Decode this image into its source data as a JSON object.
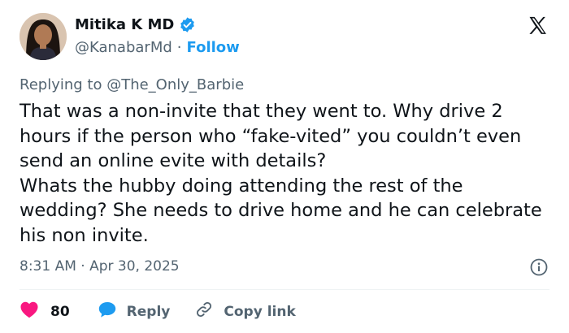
{
  "author": {
    "name": "Mitika K MD",
    "handle": "@KanabarMd",
    "separator": "·",
    "follow_label": "Follow"
  },
  "reply_context": {
    "prefix": "Replying to ",
    "mention": "@The_Only_Barbie"
  },
  "tweet": {
    "line1": "That was a non-invite that they went to. Why drive 2 hours if the person who “fake-vited” you couldn’t even send an online evite with details?",
    "line2": "Whats the hubby doing attending the rest of the wedding? She needs to drive home and he can celebrate his non invite."
  },
  "meta": {
    "time": "8:31 AM",
    "separator": "·",
    "date": "Apr 30, 2025"
  },
  "actions": {
    "like_count": "80",
    "reply_label": "Reply",
    "copy_label": "Copy link"
  },
  "colors": {
    "accent": "#1d9bf0",
    "like": "#f91880",
    "muted": "#536471",
    "text": "#0f1419"
  },
  "icons": [
    "verified-badge-icon",
    "x-logo-icon",
    "info-icon",
    "heart-icon",
    "reply-bubble-icon",
    "link-icon"
  ]
}
